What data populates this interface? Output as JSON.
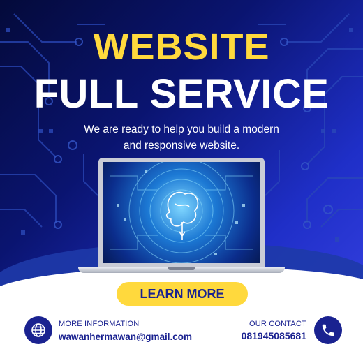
{
  "headline": {
    "line1": "WEBSITE",
    "line2": "FULL SERVICE",
    "subtitle_line1": "We are ready to help you build a modern",
    "subtitle_line2": "and responsive website."
  },
  "cta": {
    "label": "LEARN MORE"
  },
  "footer": {
    "info_label": "MORE INFORMATION",
    "email": "wawanhermawan@gmail.com",
    "contact_label": "OUR CONTACT",
    "phone": "081945085681"
  },
  "icons": {
    "info": "globe-icon",
    "contact": "phone-icon"
  },
  "colors": {
    "accent": "#ffd93d",
    "primary": "#1a2290",
    "background_dark": "#040a3a"
  }
}
